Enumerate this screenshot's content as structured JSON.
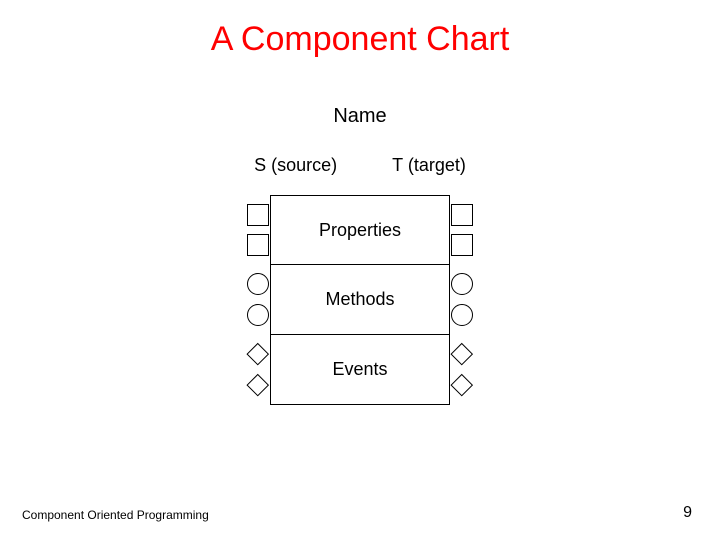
{
  "title": "A Component Chart",
  "labels": {
    "name": "Name",
    "source": "S (source)",
    "target": "T (target)"
  },
  "sections": {
    "properties": "Properties",
    "methods": "Methods",
    "events": "Events"
  },
  "footer": {
    "left": "Component Oriented Programming",
    "page": "9"
  },
  "colors": {
    "title": "#ff0000",
    "text": "#000000",
    "background": "#ffffff"
  }
}
